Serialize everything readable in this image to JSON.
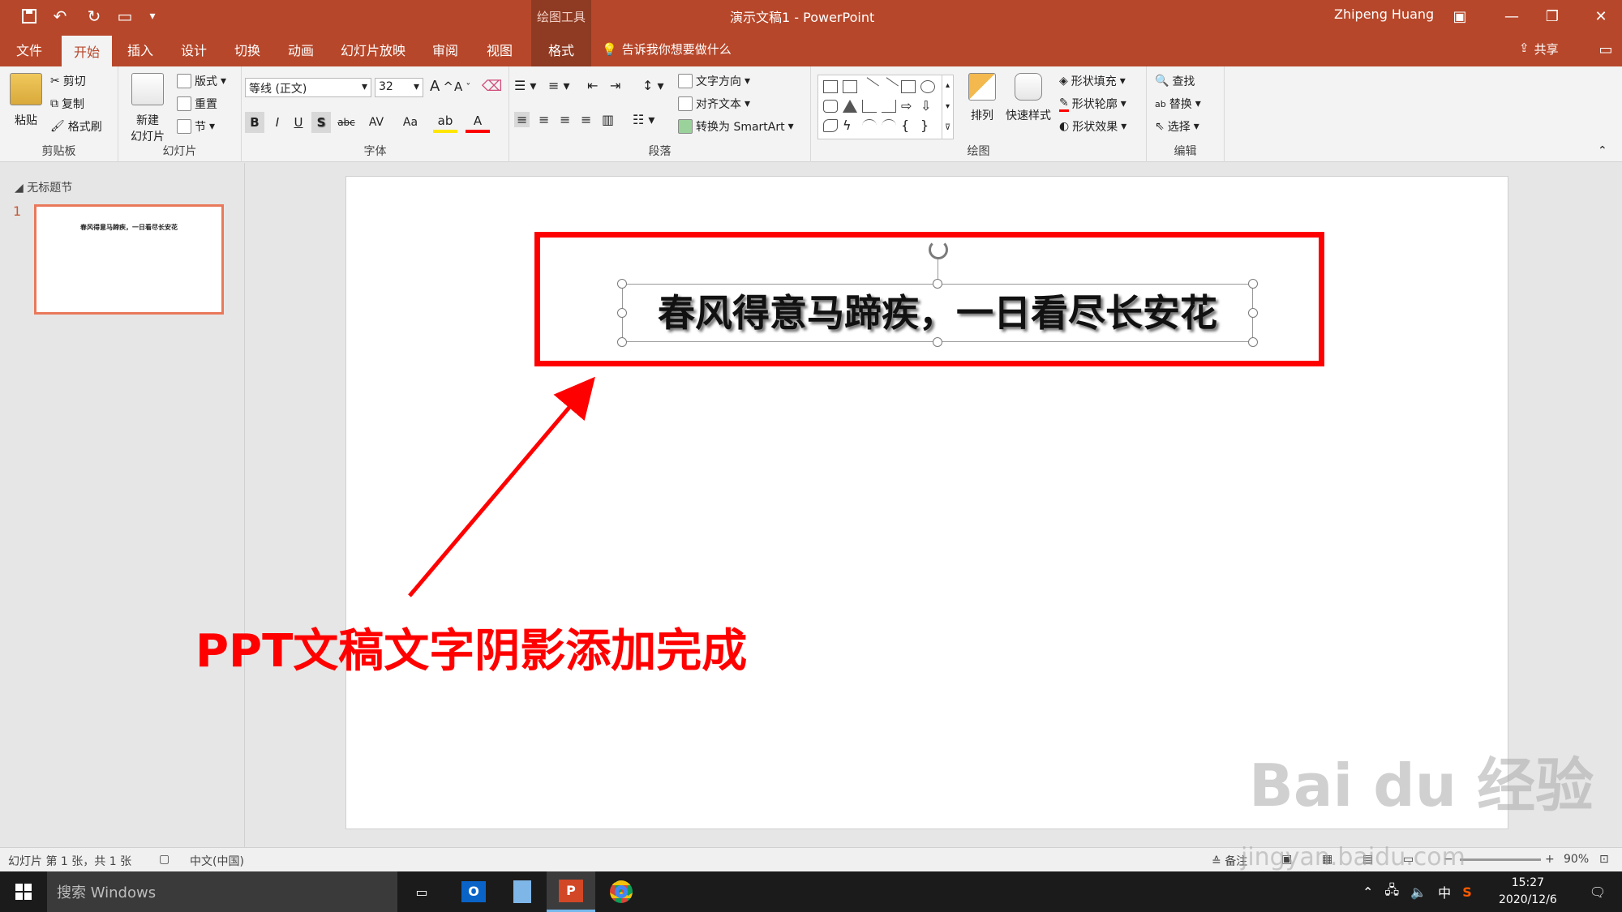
{
  "titlebar": {
    "context_tools": "绘图工具",
    "doc_title": "演示文稿1  -  PowerPoint",
    "user": "Zhipeng Huang"
  },
  "tabs": [
    "文件",
    "开始",
    "插入",
    "设计",
    "切换",
    "动画",
    "幻灯片放映",
    "审阅",
    "视图",
    "格式"
  ],
  "active_tab": "开始",
  "tell_me": "告诉我你想要做什么",
  "share": "共享",
  "ribbon": {
    "clipboard": {
      "paste": "粘贴",
      "cut": "剪切",
      "copy": "复制",
      "format_painter": "格式刷",
      "label": "剪贴板"
    },
    "slides": {
      "new_slide": "新建\n幻灯片",
      "layout": "版式",
      "reset": "重置",
      "section": "节",
      "label": "幻灯片"
    },
    "font": {
      "font_name": "等线 (正文)",
      "font_size": "32",
      "bold": "B",
      "italic": "I",
      "underline": "U",
      "shadow": "S",
      "strike": "abc",
      "spacing": "AV",
      "case": "Aa",
      "label": "字体"
    },
    "paragraph": {
      "text_direction": "文字方向",
      "align_text": "对齐文本",
      "smartart": "转换为 SmartArt",
      "label": "段落"
    },
    "drawing": {
      "arrange": "排列",
      "quick_styles": "快速样式",
      "shape_fill": "形状填充",
      "shape_outline": "形状轮廓",
      "shape_effects": "形状效果",
      "label": "绘图"
    },
    "editing": {
      "find": "查找",
      "replace": "替换",
      "select": "选择",
      "label": "编辑"
    }
  },
  "left_pane": {
    "section_name": "无标题节",
    "slide_number": "1",
    "thumb_text": "春风得意马蹄疾，一日看尽长安花"
  },
  "slide": {
    "text": "春风得意马蹄疾，一日看尽长安花",
    "caption": "PPT文稿文字阴影添加完成"
  },
  "watermark": {
    "logo": "Bai du 经验",
    "url": "jingyan.baidu.com"
  },
  "statusbar": {
    "slide_info": "幻灯片 第 1 张，共 1 张",
    "language": "中文(中国)",
    "notes": "备注",
    "zoom": "90%"
  },
  "taskbar": {
    "search_placeholder": "搜索 Windows",
    "ime": "中",
    "time": "15:27",
    "date": "2020/12/6"
  },
  "colors": {
    "accent": "#b7472a",
    "highlight_red": "#ff0000"
  }
}
